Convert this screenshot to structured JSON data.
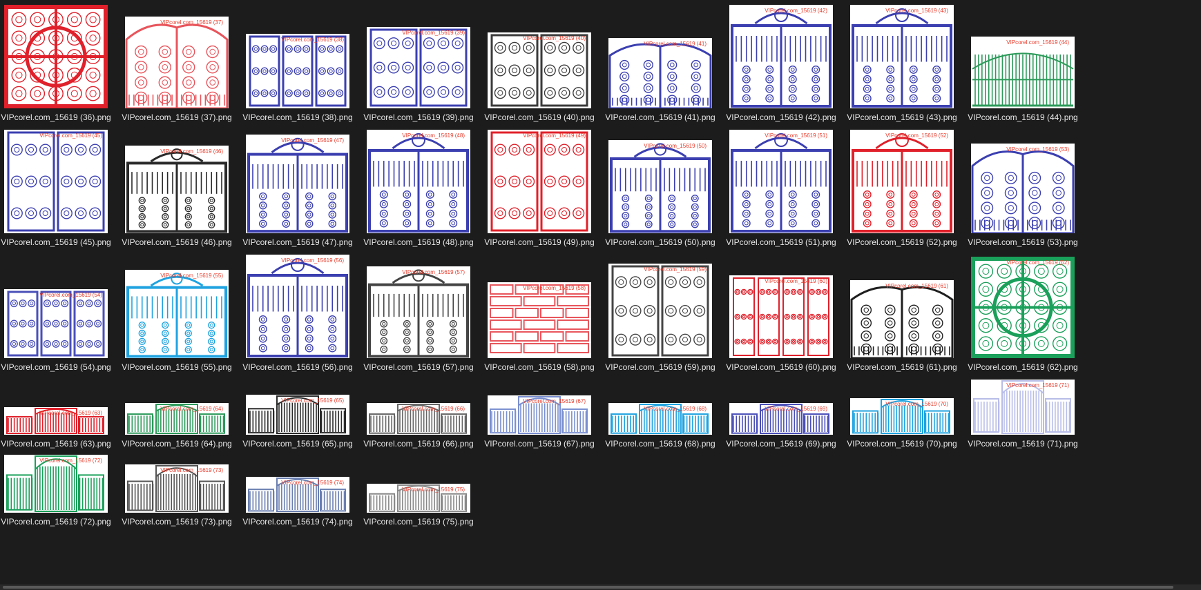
{
  "files": [
    {
      "name": "VIPcorel.com_15619 (36).png",
      "watermark": "",
      "color": "#e0202a",
      "pattern": "screen"
    },
    {
      "name": "VIPcorel.com_15619 (37).png",
      "watermark": "VIPcorel.com_15619 (37)",
      "color": "#e8555c",
      "pattern": "gate-arch"
    },
    {
      "name": "VIPcorel.com_15619 (38).png",
      "watermark": "VIPcorel.com_15619 (38)",
      "color": "#3b3fb0",
      "pattern": "panels3"
    },
    {
      "name": "VIPcorel.com_15619 (39).png",
      "watermark": "VIPcorel.com_15619 (39)",
      "color": "#3b3fb0",
      "pattern": "panels2"
    },
    {
      "name": "VIPcorel.com_15619 (40).png",
      "watermark": "VIPcorel.com_15619 (40)",
      "color": "#3a3a3a",
      "pattern": "panels2"
    },
    {
      "name": "VIPcorel.com_15619 (41).png",
      "watermark": "VIPcorel.com_15619 (41)",
      "color": "#3b3fb0",
      "pattern": "gate-arch"
    },
    {
      "name": "VIPcorel.com_15619 (42).png",
      "watermark": "VIPcorel.com_15619 (42)",
      "color": "#3b3fb0",
      "pattern": "gate-crown"
    },
    {
      "name": "VIPcorel.com_15619 (43).png",
      "watermark": "VIPcorel.com_15619 (43)",
      "color": "#3b3fb0",
      "pattern": "gate-crown"
    },
    {
      "name": "VIPcorel.com_15619 (44).png",
      "watermark": "VIPcorel.com_15619 (44)",
      "color": "#2c9a5a",
      "pattern": "fence"
    },
    {
      "name": "VIPcorel.com_15619 (45).png",
      "watermark": "VIPcorel.com_15619 (45)",
      "color": "#3b3fb0",
      "pattern": "panels2"
    },
    {
      "name": "VIPcorel.com_15619 (46).png",
      "watermark": "VIPcorel.com_15619 (46)",
      "color": "#2a2a2a",
      "pattern": "gate-crown"
    },
    {
      "name": "VIPcorel.com_15619 (47).png",
      "watermark": "VIPcorel.com_15619 (47)",
      "color": "#3b3fb0",
      "pattern": "gate-crown"
    },
    {
      "name": "VIPcorel.com_15619 (48).png",
      "watermark": "VIPcorel.com_15619 (48)",
      "color": "#3b3fb0",
      "pattern": "gate-crown"
    },
    {
      "name": "VIPcorel.com_15619 (49).png",
      "watermark": "VIPcorel.com_15619 (49)",
      "color": "#e0202a",
      "pattern": "panels2"
    },
    {
      "name": "VIPcorel.com_15619 (50).png",
      "watermark": "VIPcorel.com_15619 (50)",
      "color": "#3b3fb0",
      "pattern": "gate-crown"
    },
    {
      "name": "VIPcorel.com_15619 (51).png",
      "watermark": "VIPcorel.com_15619 (51)",
      "color": "#3b3fb0",
      "pattern": "gate-crown"
    },
    {
      "name": "VIPcorel.com_15619 (52).png",
      "watermark": "VIPcorel.com_15619 (52)",
      "color": "#e0202a",
      "pattern": "gate-crown"
    },
    {
      "name": "VIPcorel.com_15619 (53).png",
      "watermark": "VIPcorel.com_15619 (53)",
      "color": "#3b3fb0",
      "pattern": "gate-arch"
    },
    {
      "name": "VIPcorel.com_15619 (54).png",
      "watermark": "VIPcorel.com_15619 (54)",
      "color": "#4a4fb8",
      "pattern": "panels3"
    },
    {
      "name": "VIPcorel.com_15619 (55).png",
      "watermark": "VIPcorel.com_15619 (55)",
      "color": "#1fa3e0",
      "pattern": "gate-crown"
    },
    {
      "name": "VIPcorel.com_15619 (56).png",
      "watermark": "VIPcorel.com_15619 (56)",
      "color": "#3b3fb0",
      "pattern": "gate-crown"
    },
    {
      "name": "VIPcorel.com_15619 (57).png",
      "watermark": "VIPcorel.com_15619 (57)",
      "color": "#444444",
      "pattern": "gate-crown"
    },
    {
      "name": "VIPcorel.com_15619 (58).png",
      "watermark": "VIPcorel.com_15619 (58)",
      "color": "#e8555c",
      "pattern": "strips"
    },
    {
      "name": "VIPcorel.com_15619 (59).png",
      "watermark": "VIPcorel.com_15619 (59)",
      "color": "#444444",
      "pattern": "panels2"
    },
    {
      "name": "VIPcorel.com_15619 (60).png",
      "watermark": "VIPcorel.com_15619 (60)",
      "color": "#e0202a",
      "pattern": "panels4"
    },
    {
      "name": "VIPcorel.com_15619 (61).png",
      "watermark": "VIPcorel.com_15619 (61)",
      "color": "#1e1e1e",
      "pattern": "gate-arch"
    },
    {
      "name": "VIPcorel.com_15619 (62).png",
      "watermark": "VIPcorel.com_15619 (62)",
      "color": "#1aa05a",
      "pattern": "screen"
    },
    {
      "name": "VIPcorel.com_15619 (63).png",
      "watermark": "VIPcorel.com_15619 (63)",
      "color": "#e0202a",
      "pattern": "fence-wide"
    },
    {
      "name": "VIPcorel.com_15619 (64).png",
      "watermark": "VIPcorel.com_15619 (64)",
      "color": "#2c9a5a",
      "pattern": "fence-wide"
    },
    {
      "name": "VIPcorel.com_15619 (65).png",
      "watermark": "VIPcorel.com_15619 (65)",
      "color": "#2a2a2a",
      "pattern": "fence-wide"
    },
    {
      "name": "VIPcorel.com_15619 (66).png",
      "watermark": "VIPcorel.com_15619 (66)",
      "color": "#666666",
      "pattern": "fence-wide"
    },
    {
      "name": "VIPcorel.com_15619 (67).png",
      "watermark": "VIPcorel.com_15619 (67)",
      "color": "#7a8fd0",
      "pattern": "fence-wide"
    },
    {
      "name": "VIPcorel.com_15619 (68).png",
      "watermark": "VIPcorel.com_15619 (68)",
      "color": "#1fa3e0",
      "pattern": "fence-wide"
    },
    {
      "name": "VIPcorel.com_15619 (69).png",
      "watermark": "VIPcorel.com_15619 (69)",
      "color": "#4a4fb8",
      "pattern": "fence-wide"
    },
    {
      "name": "VIPcorel.com_15619 (70).png",
      "watermark": "VIPcorel.com_15619 (70)",
      "color": "#1fa3e0",
      "pattern": "fence-wide"
    },
    {
      "name": "VIPcorel.com_15619 (71).png",
      "watermark": "VIPcorel.com_15619 (71)",
      "color": "#b8bde8",
      "pattern": "fence-wide"
    },
    {
      "name": "VIPcorel.com_15619 (72).png",
      "watermark": "VIPcorel.com_15619 (72)",
      "color": "#1aa05a",
      "pattern": "fence-wide"
    },
    {
      "name": "VIPcorel.com_15619 (73).png",
      "watermark": "VIPcorel.com_15619 (73)",
      "color": "#555555",
      "pattern": "fence-wide"
    },
    {
      "name": "VIPcorel.com_15619 (74).png",
      "watermark": "VIPcorel.com_15619 (74)",
      "color": "#6a7fb0",
      "pattern": "fence-wide"
    },
    {
      "name": "VIPcorel.com_15619 (75).png",
      "watermark": "VIPcorel.com_15619 (75)",
      "color": "#888888",
      "pattern": "fence-wide"
    }
  ]
}
